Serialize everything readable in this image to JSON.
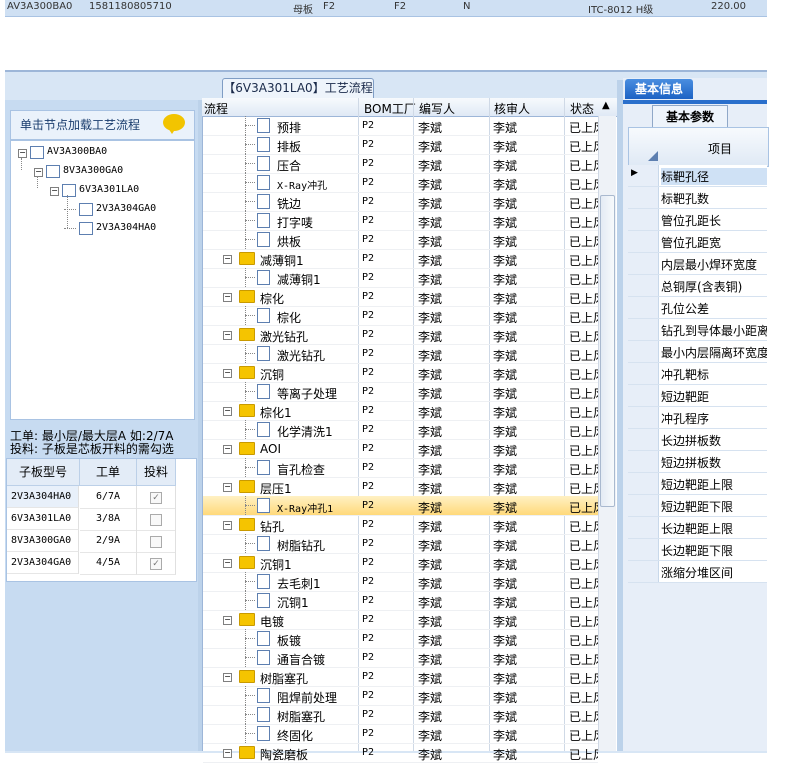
{
  "top_strip": {
    "c1": "AV3A300BA0",
    "c2": "1581180805710",
    "c3": "母板",
    "c4": "F2",
    "c5": "F2",
    "c6": "N",
    "c7": "ITC-8012 H级",
    "c8": "220.00"
  },
  "flow_tab": {
    "title": "【6V3A301LA0】工艺流程"
  },
  "left": {
    "hint": "单击节点加载工艺流程",
    "tree": [
      {
        "label": "AV3A300BA0",
        "level": 0,
        "toggle": "−"
      },
      {
        "label": "8V3A300GA0",
        "level": 1,
        "toggle": "−"
      },
      {
        "label": "6V3A301LA0",
        "level": 2,
        "toggle": "−"
      },
      {
        "label": "2V3A304GA0",
        "level": 3,
        "toggle": ""
      },
      {
        "label": "2V3A304HA0",
        "level": 3,
        "toggle": ""
      }
    ],
    "info1": "工单: 最小层/最大层A 如:2/7A",
    "info2": "投料: 子板是芯板开料的需勾选",
    "sub_table": {
      "headers": [
        "子板型号",
        "工单",
        "投料"
      ],
      "rows": [
        {
          "model": "2V3A304HA0",
          "order": "6/7A",
          "checked": true
        },
        {
          "model": "6V3A301LA0",
          "order": "3/8A",
          "checked": false
        },
        {
          "model": "8V3A300GA0",
          "order": "2/9A",
          "checked": false
        },
        {
          "model": "2V3A304GA0",
          "order": "4/5A",
          "checked": true
        }
      ]
    }
  },
  "grid": {
    "headers": [
      "流程",
      "BOM工厂",
      "编写人",
      "核审人",
      "状态"
    ],
    "rows": [
      {
        "type": "child",
        "name": "预排",
        "bom": "P2",
        "writer": "李斌",
        "reviewer": "李斌",
        "status": "已上风"
      },
      {
        "type": "child",
        "name": "排板",
        "bom": "P2",
        "writer": "李斌",
        "reviewer": "李斌",
        "status": "已上风"
      },
      {
        "type": "child",
        "name": "压合",
        "bom": "P2",
        "writer": "李斌",
        "reviewer": "李斌",
        "status": "已上风"
      },
      {
        "type": "child",
        "name": "X-Ray冲孔",
        "bom": "P2",
        "writer": "李斌",
        "reviewer": "李斌",
        "status": "已上风"
      },
      {
        "type": "child",
        "name": "铣边",
        "bom": "P2",
        "writer": "李斌",
        "reviewer": "李斌",
        "status": "已上风"
      },
      {
        "type": "child",
        "name": "打字唛",
        "bom": "P2",
        "writer": "李斌",
        "reviewer": "李斌",
        "status": "已上风"
      },
      {
        "type": "child",
        "name": "烘板",
        "bom": "P2",
        "writer": "李斌",
        "reviewer": "李斌",
        "status": "已上风"
      },
      {
        "type": "group",
        "name": "减薄铜1",
        "bom": "P2",
        "writer": "李斌",
        "reviewer": "李斌",
        "status": "已上风"
      },
      {
        "type": "child",
        "name": "减薄铜1",
        "bom": "P2",
        "writer": "李斌",
        "reviewer": "李斌",
        "status": "已上风"
      },
      {
        "type": "group",
        "name": "棕化",
        "bom": "P2",
        "writer": "李斌",
        "reviewer": "李斌",
        "status": "已上风"
      },
      {
        "type": "child",
        "name": "棕化",
        "bom": "P2",
        "writer": "李斌",
        "reviewer": "李斌",
        "status": "已上风"
      },
      {
        "type": "group",
        "name": "激光钻孔",
        "bom": "P2",
        "writer": "李斌",
        "reviewer": "李斌",
        "status": "已上风"
      },
      {
        "type": "child",
        "name": "激光钻孔",
        "bom": "P2",
        "writer": "李斌",
        "reviewer": "李斌",
        "status": "已上风"
      },
      {
        "type": "group",
        "name": "沉铜",
        "bom": "P2",
        "writer": "李斌",
        "reviewer": "李斌",
        "status": "已上风"
      },
      {
        "type": "child",
        "name": "等离子处理",
        "bom": "P2",
        "writer": "李斌",
        "reviewer": "李斌",
        "status": "已上风"
      },
      {
        "type": "group",
        "name": "棕化1",
        "bom": "P2",
        "writer": "李斌",
        "reviewer": "李斌",
        "status": "已上风"
      },
      {
        "type": "child",
        "name": "化学清洗1",
        "bom": "P2",
        "writer": "李斌",
        "reviewer": "李斌",
        "status": "已上风"
      },
      {
        "type": "group",
        "name": "AOI",
        "bom": "P2",
        "writer": "李斌",
        "reviewer": "李斌",
        "status": "已上风"
      },
      {
        "type": "child",
        "name": "盲孔检查",
        "bom": "P2",
        "writer": "李斌",
        "reviewer": "李斌",
        "status": "已上风"
      },
      {
        "type": "group",
        "name": "层压1",
        "bom": "P2",
        "writer": "李斌",
        "reviewer": "李斌",
        "status": "已上风"
      },
      {
        "type": "child",
        "name": "X-Ray冲孔1",
        "bom": "P2",
        "writer": "李斌",
        "reviewer": "李斌",
        "status": "已上风",
        "selected": true
      },
      {
        "type": "group",
        "name": "钻孔",
        "bom": "P2",
        "writer": "李斌",
        "reviewer": "李斌",
        "status": "已上风"
      },
      {
        "type": "child",
        "name": "树脂钻孔",
        "bom": "P2",
        "writer": "李斌",
        "reviewer": "李斌",
        "status": "已上风"
      },
      {
        "type": "group",
        "name": "沉铜1",
        "bom": "P2",
        "writer": "李斌",
        "reviewer": "李斌",
        "status": "已上风"
      },
      {
        "type": "child",
        "name": "去毛刺1",
        "bom": "P2",
        "writer": "李斌",
        "reviewer": "李斌",
        "status": "已上风"
      },
      {
        "type": "child",
        "name": "沉铜1",
        "bom": "P2",
        "writer": "李斌",
        "reviewer": "李斌",
        "status": "已上风"
      },
      {
        "type": "group",
        "name": "电镀",
        "bom": "P2",
        "writer": "李斌",
        "reviewer": "李斌",
        "status": "已上风"
      },
      {
        "type": "child",
        "name": "板镀",
        "bom": "P2",
        "writer": "李斌",
        "reviewer": "李斌",
        "status": "已上风"
      },
      {
        "type": "child",
        "name": "通盲合镀",
        "bom": "P2",
        "writer": "李斌",
        "reviewer": "李斌",
        "status": "已上风"
      },
      {
        "type": "group",
        "name": "树脂塞孔",
        "bom": "P2",
        "writer": "李斌",
        "reviewer": "李斌",
        "status": "已上风"
      },
      {
        "type": "child",
        "name": "阻焊前处理",
        "bom": "P2",
        "writer": "李斌",
        "reviewer": "李斌",
        "status": "已上风"
      },
      {
        "type": "child",
        "name": "树脂塞孔",
        "bom": "P2",
        "writer": "李斌",
        "reviewer": "李斌",
        "status": "已上风"
      },
      {
        "type": "child",
        "name": "终固化",
        "bom": "P2",
        "writer": "李斌",
        "reviewer": "李斌",
        "status": "已上风"
      },
      {
        "type": "group",
        "name": "陶瓷磨板",
        "bom": "P2",
        "writer": "李斌",
        "reviewer": "李斌",
        "status": "已上风"
      }
    ]
  },
  "right": {
    "tab_basic": "基本信息",
    "tab_params": "基本参数",
    "column_header": "项目",
    "items": [
      "标靶孔径",
      "标靶孔数",
      "管位孔距长",
      "管位孔距宽",
      "内层最小焊环宽度",
      "总铜厚(含表铜)",
      "孔位公差",
      "钻孔到导体最小距离",
      "最小内层隔离环宽度",
      "冲孔靶标",
      "短边靶距",
      "冲孔程序",
      "长边拼板数",
      "短边拼板数",
      "短边靶距上限",
      "短边靶距下限",
      "长边靶距上限",
      "长边靶距下限",
      "涨缩分堆区间"
    ]
  },
  "colors": {
    "accent": "#1c62c4",
    "selected_row": "#ffd97a",
    "folder": "#f5c400",
    "hint_bubble": "#f2c400"
  }
}
